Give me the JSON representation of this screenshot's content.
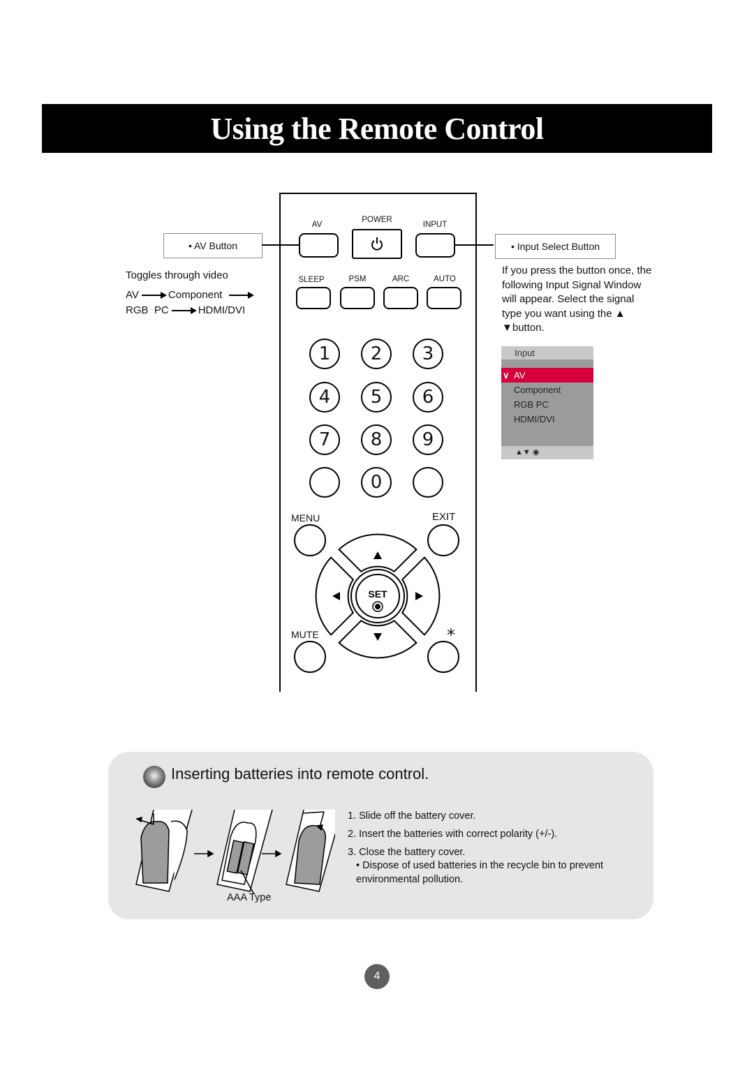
{
  "title": "Using the Remote Control",
  "av_callout": {
    "label": "• AV Button",
    "description": "Toggles through video",
    "sequence": [
      "AV",
      "Component",
      "RGB  PC",
      "HDMI/DVI"
    ]
  },
  "input_callout": {
    "label": "• Input Select Button",
    "description": "If you press the button once, the following Input Signal Window will appear. Select the signal type you want using the ▲ ▼button."
  },
  "input_window": {
    "title": "Input",
    "items": [
      {
        "label": "AV",
        "selected": true
      },
      {
        "label": "Component",
        "selected": false
      },
      {
        "label": "RGB PC",
        "selected": false
      },
      {
        "label": "HDMI/DVI",
        "selected": false
      }
    ],
    "selected_marker": "∨",
    "footer": "▲▼ ◉",
    "highlight_color": "#d6003c"
  },
  "remote": {
    "top_buttons": {
      "av": "AV",
      "power": "POWER",
      "input": "INPUT"
    },
    "function_buttons": [
      "SLEEP",
      "PSM",
      "ARC",
      "AUTO"
    ],
    "number_buttons": [
      "1",
      "2",
      "3",
      "4",
      "5",
      "6",
      "7",
      "8",
      "9",
      "",
      "0",
      ""
    ],
    "menu": "MENU",
    "exit": "EXIT",
    "mute": "MUTE",
    "star": "*",
    "set": "SET"
  },
  "batteries": {
    "heading": "Inserting batteries into remote control.",
    "steps": [
      "1. Slide off the battery cover.",
      "2. Insert the batteries with correct polarity (+/-).",
      "3. Close the battery cover."
    ],
    "note": "• Dispose of used batteries in the recycle bin to prevent environmental pollution.",
    "battery_type": "AAA Type"
  },
  "page_number": "4"
}
